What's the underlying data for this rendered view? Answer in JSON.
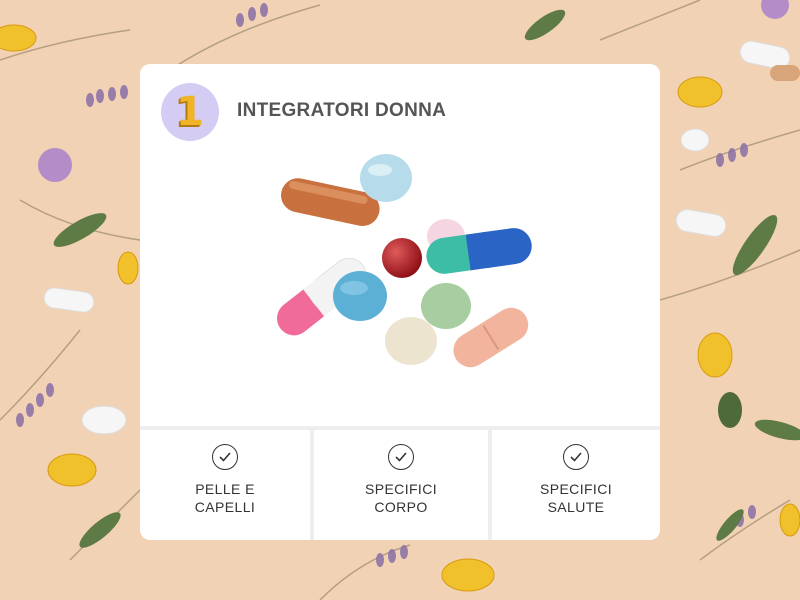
{
  "card": {
    "badge_number": "1",
    "title": "INTEGRATORI DONNA",
    "image_icon": "pills-capsules-image"
  },
  "features": [
    {
      "label": "PELLE E CAPELLI",
      "icon": "check-circle-icon"
    },
    {
      "label": "SPECIFICI CORPO",
      "icon": "check-circle-icon"
    },
    {
      "label": "SPECIFICI SALUTE",
      "icon": "check-circle-icon"
    }
  ],
  "colors": {
    "background": "#f1d2b4",
    "badge_background": "#d4ccf3",
    "badge_number": "#f0b429",
    "title_text": "#555555",
    "feature_text": "#333333",
    "divider": "#eeeeee"
  }
}
